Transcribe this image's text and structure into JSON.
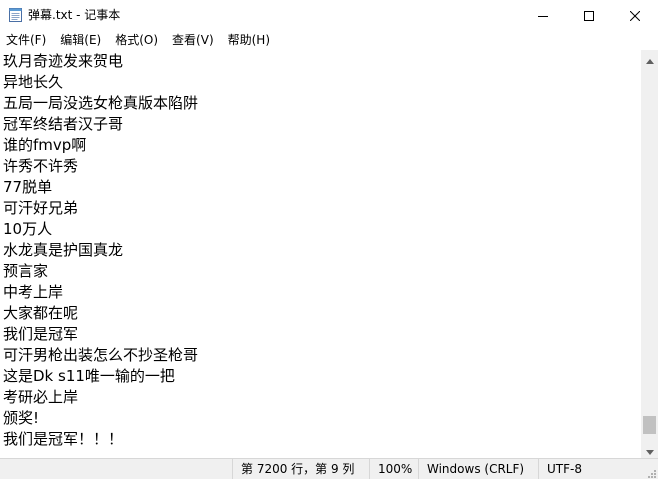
{
  "window": {
    "title": "弹幕.txt - 记事本"
  },
  "titlebar": {
    "icons": {
      "app": "notepad-icon",
      "minimize": "minimize-icon",
      "maximize": "maximize-icon",
      "close": "close-icon"
    }
  },
  "menu": {
    "items": [
      {
        "label": "文件(F)"
      },
      {
        "label": "编辑(E)"
      },
      {
        "label": "格式(O)"
      },
      {
        "label": "查看(V)"
      },
      {
        "label": "帮助(H)"
      }
    ]
  },
  "editor": {
    "lines": [
      "玖月奇迹发来贺电",
      "异地长久",
      "五局一局没选女枪真版本陷阱",
      "冠军终结者汉子哥",
      "谁的fmvp啊",
      "许秀不许秀",
      "77脱单",
      "可汗好兄弟",
      "10万人",
      "水龙真是护国真龙",
      "预言家",
      "中考上岸",
      "大家都在呢",
      "我们是冠军",
      "可汗男枪出装怎么不抄圣枪哥",
      "这是Dk s11唯一输的一把",
      "考研必上岸",
      "颁奖!",
      "我们是冠军！！！"
    ]
  },
  "scrollbar": {
    "position_fraction": 0.98
  },
  "status": {
    "position": "第 7200 行，第 9 列",
    "zoom": "100%",
    "line_ending": "Windows (CRLF)",
    "encoding": "UTF-8"
  }
}
